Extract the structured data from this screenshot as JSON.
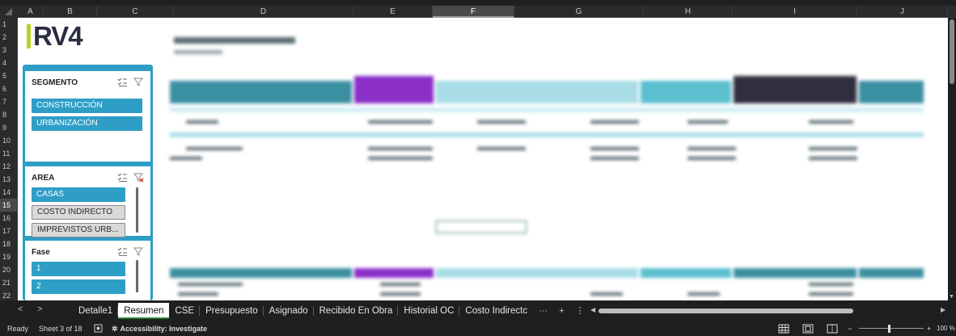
{
  "columns": [
    {
      "label": "A",
      "sel": false
    },
    {
      "label": "B",
      "sel": false
    },
    {
      "label": "C",
      "sel": false
    },
    {
      "label": "D",
      "sel": false
    },
    {
      "label": "E",
      "sel": false
    },
    {
      "label": "F",
      "sel": true
    },
    {
      "label": "G",
      "sel": false
    },
    {
      "label": "H",
      "sel": false
    },
    {
      "label": "I",
      "sel": false
    },
    {
      "label": "J",
      "sel": false
    }
  ],
  "rows": [
    "1",
    "2",
    "3",
    "4",
    "5",
    "6",
    "7",
    "8",
    "9",
    "10",
    "11",
    "12",
    "13",
    "14",
    "15",
    "16",
    "17",
    "18",
    "19",
    "20",
    "21",
    "22"
  ],
  "selected_row": "15",
  "logo": {
    "text": "RV4"
  },
  "slicers": [
    {
      "title": "SEGMENTO",
      "items": [
        {
          "label": "CONSTRUCCIÓN",
          "on": true
        },
        {
          "label": "URBANIZACIÓN",
          "on": true
        }
      ]
    },
    {
      "title": "AREA",
      "items": [
        {
          "label": "CASAS",
          "on": true
        },
        {
          "label": "COSTO INDIRECTO",
          "on": false
        },
        {
          "label": "IMPREVISTOS URB...",
          "on": false
        }
      ]
    },
    {
      "title": "Fase",
      "items": [
        {
          "label": "1",
          "on": true
        },
        {
          "label": "2",
          "on": true
        }
      ]
    }
  ],
  "colors": {
    "slicer_blue": "#2e9ec7",
    "pivot_teal": "#3a8fa0",
    "pivot_purple": "#8b2fc9",
    "pivot_light": "#a8dde8",
    "pivot_dark": "#2f2f3f",
    "logo_green": "#b8d128"
  },
  "sheet_tabs": [
    {
      "label": "Detalle1",
      "active": false
    },
    {
      "label": "Resumen",
      "active": true
    },
    {
      "label": "CSE",
      "active": false
    },
    {
      "label": "Presupuesto",
      "active": false
    },
    {
      "label": "Asignado",
      "active": false
    },
    {
      "label": "Recibido En Obra",
      "active": false
    },
    {
      "label": "Historial OC",
      "active": false
    },
    {
      "label": "Costo Indirectc",
      "active": false
    }
  ],
  "tab_controls": {
    "more": "···",
    "add": "+",
    "options": "⋮"
  },
  "status": {
    "ready": "Ready",
    "sheet": "Sheet 3 of 18",
    "accessibility": "Accessibility: Investigate",
    "zoom": "100 %",
    "zoom_minus": "−",
    "zoom_plus": "+"
  }
}
